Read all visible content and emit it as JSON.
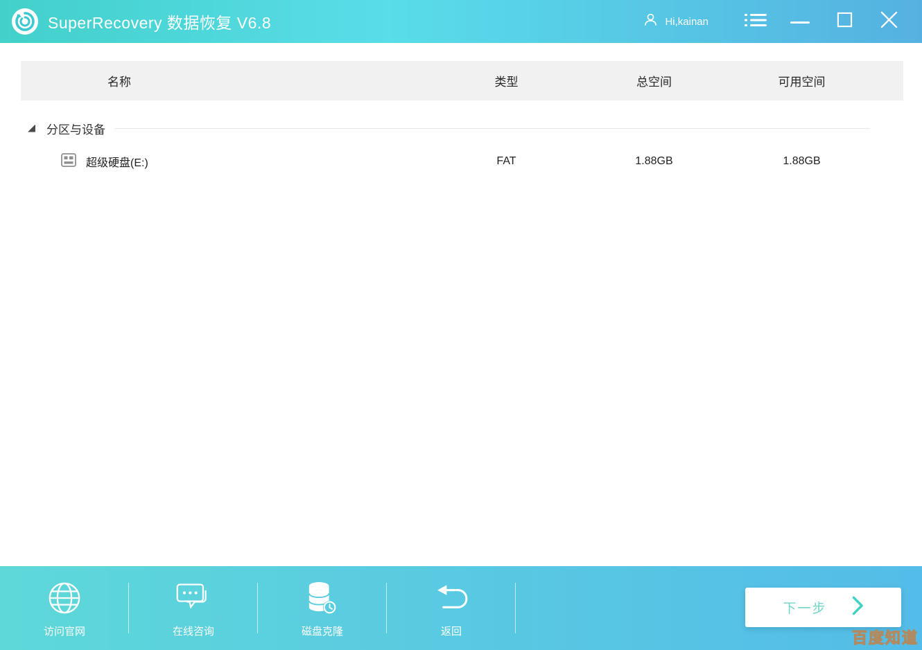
{
  "titlebar": {
    "title": "SuperRecovery 数据恢复 V6.8",
    "user_greeting": "Hi,kainan",
    "icons": [
      "app-logo-icon",
      "user-icon",
      "menu-list-icon",
      "minimize-icon",
      "maximize-icon",
      "close-icon"
    ]
  },
  "table": {
    "columns": [
      "名称",
      "类型",
      "总空间",
      "可用空间"
    ],
    "group_label": "分区与设备",
    "rows": [
      {
        "name": "超级硬盘(E:)",
        "type": "FAT",
        "total": "1.88GB",
        "available": "1.88GB",
        "icon": "drive-icon"
      }
    ]
  },
  "bottombar": {
    "items": [
      {
        "label": "访问官网",
        "icon": "globe-icon"
      },
      {
        "label": "在线咨询",
        "icon": "chat-icon"
      },
      {
        "label": "磁盘克隆",
        "icon": "disk-clone-icon"
      },
      {
        "label": "返回",
        "icon": "back-icon"
      }
    ],
    "next_label": "下一步",
    "next_icon": "chevron-right-icon"
  },
  "watermark": "百度知道",
  "colors": {
    "titlebar_gradient_left": "#43d0ca",
    "titlebar_gradient_mid": "#58dde9",
    "titlebar_gradient_right": "#55b1e1",
    "bottombar_gradient_left": "#5ed8d9",
    "bottombar_gradient_right": "#54bce8",
    "header_bg": "#f1f1f1",
    "accent_teal": "#3fd1c2",
    "next_text": "#6fd6c6",
    "text_dark": "#262626",
    "watermark_stroke": "#b28a62"
  }
}
